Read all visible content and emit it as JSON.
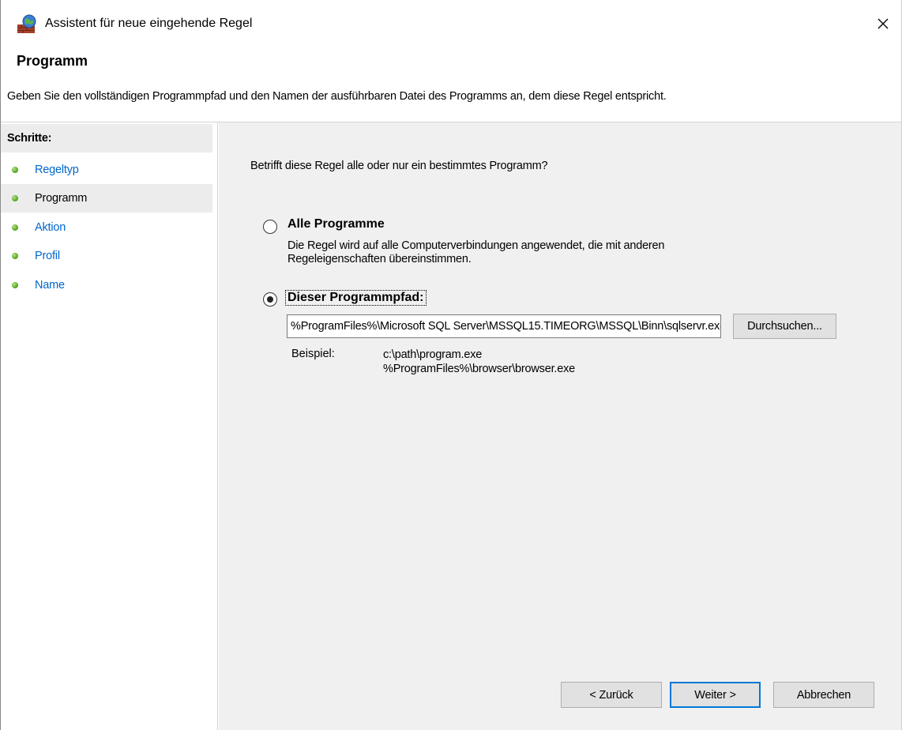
{
  "window": {
    "title": "Assistent für neue eingehende Regel"
  },
  "header": {
    "title": "Programm",
    "description": "Geben Sie den vollständigen Programmpfad und den Namen der ausführbaren Datei des Programms an, dem diese Regel entspricht."
  },
  "sidebar": {
    "heading": "Schritte:",
    "steps": [
      {
        "label": "Regeltyp"
      },
      {
        "label": "Programm"
      },
      {
        "label": "Aktion"
      },
      {
        "label": "Profil"
      },
      {
        "label": "Name"
      }
    ],
    "active_step": "Programm"
  },
  "main": {
    "question": "Betrifft diese Regel alle oder nur ein bestimmtes Programm?",
    "option_all": {
      "label": "Alle Programme",
      "description_line1": "Die Regel wird auf alle Computerverbindungen angewendet, die mit anderen",
      "description_line2": "Regeleigenschaften übereinstimmen.",
      "selected": false
    },
    "option_path": {
      "label": "Dieser Programmpfad:",
      "selected": true
    },
    "path_value": "%ProgramFiles%\\Microsoft SQL Server\\MSSQL15.TIMEORG\\MSSQL\\Binn\\sqlservr.exe",
    "browse_label": "Durchsuchen...",
    "example_label": "Beispiel:",
    "example_line1": "c:\\path\\program.exe",
    "example_line2": "%ProgramFiles%\\browser\\browser.exe"
  },
  "footer": {
    "back_label": "< Zurück",
    "next_label": "Weiter >",
    "cancel_label": "Abbrechen"
  },
  "colors": {
    "link": "#0066cc",
    "content_bg": "#f0f0f0",
    "primary_border": "#0078d7",
    "step_dot": "#5fae2b"
  },
  "icons": {
    "app": "firewall-globe-icon",
    "close": "close-icon",
    "step": "green-dot-icon"
  }
}
